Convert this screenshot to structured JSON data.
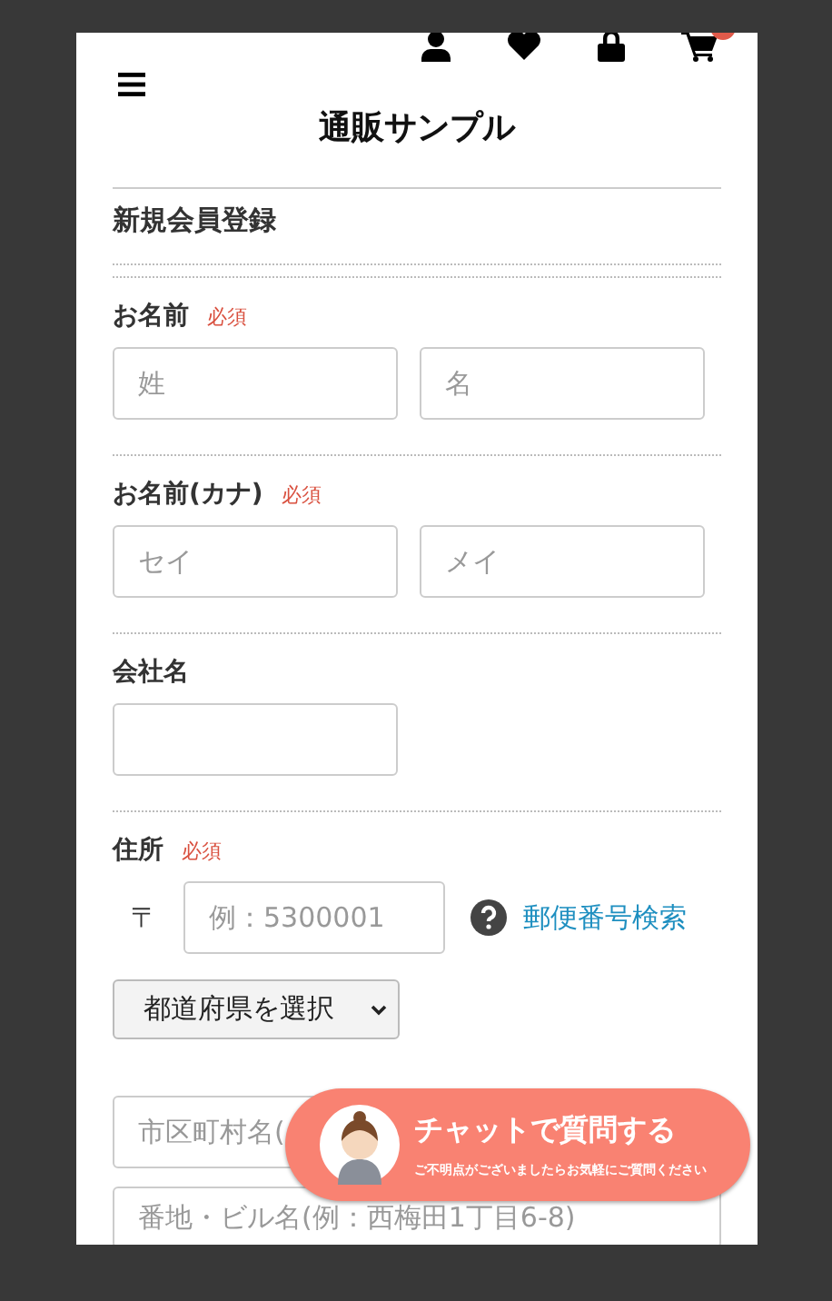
{
  "header": {
    "title": "通販サンプル"
  },
  "section_title": "新規会員登録",
  "fields": [
    {
      "kind": "pair",
      "label": "お名前",
      "required_mark": "必須",
      "placeholders": [
        "姓",
        "名"
      ]
    },
    {
      "kind": "pair",
      "label": "お名前(カナ)",
      "required_mark": "必須",
      "placeholders": [
        "セイ",
        "メイ"
      ]
    },
    {
      "kind": "single",
      "label": "会社名"
    },
    {
      "kind": "address",
      "label": "住所",
      "required_mark": "必須",
      "postal_mark": "〒",
      "postal_placeholder": "例：5300001",
      "lookup_link": "郵便番号検索",
      "prefecture_select": "都道府県を選択",
      "city_placeholder": "市区町村名(",
      "street_placeholder": "番地・ビル名(例：西梅田1丁目6-8)"
    }
  ],
  "chat": {
    "title": "チャットで質問する",
    "subtitle": "ご不明点がございましたらお気軽にご質問ください"
  }
}
